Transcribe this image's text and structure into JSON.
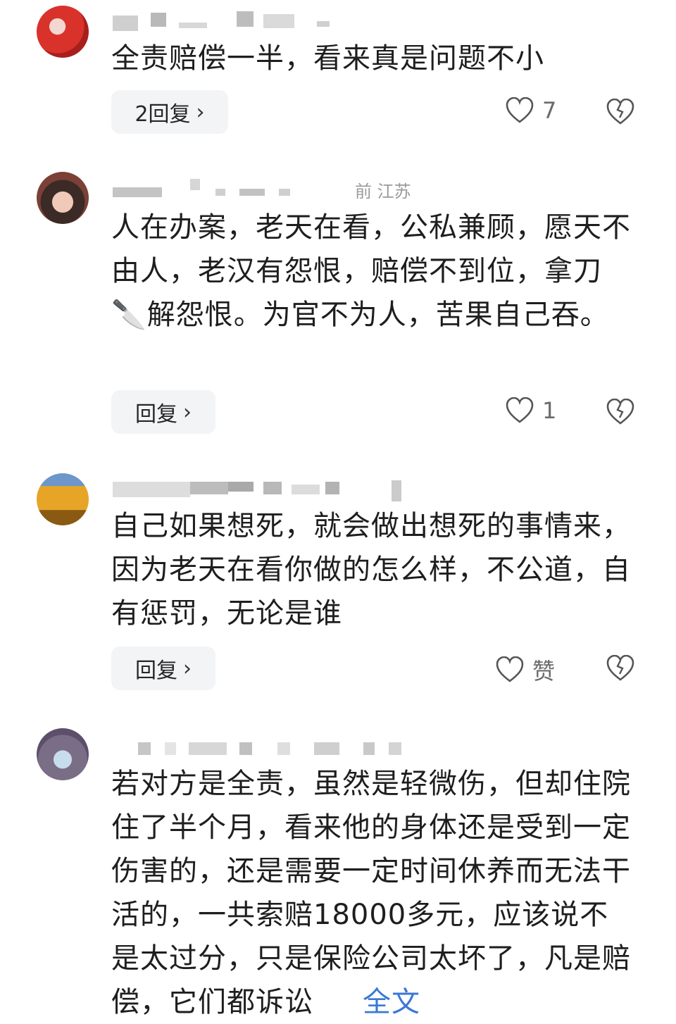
{
  "comments": [
    {
      "text": "全责赔偿一半，看来真是问题不小",
      "reply_label": "2回复",
      "likes": "7"
    },
    {
      "meta_visible": "前  江苏",
      "text": "人在办案，老天在看，公私兼顾，愿天不由人，老汉有怨恨，赔偿不到位，拿刀🔪解怨恨。为官不为人，苦果自己吞。",
      "reply_label": "回复",
      "likes": "1"
    },
    {
      "text": "自己如果想死，就会做出想死的事情来，因为老天在看你做的怎么样，不公道，自有惩罚，无论是谁",
      "reply_label": "回复",
      "likes": "赞"
    },
    {
      "text": "若对方是全责，虽然是轻微伤，但却住院住了半个月，看来他的身体还是受到一定伤害的，还是需要一定时间休养而无法干活的，一共索赔18000多元，应该说不是太过分，只是保险公司太坏了，凡是赔偿，它们都诉讼",
      "full_text_link": "全文"
    }
  ],
  "icons": {
    "like": "heart-outline-icon",
    "dislike": "broken-heart-icon",
    "chevron": "chevron-right-icon"
  },
  "colors": {
    "link": "#3a78d8",
    "button_bg": "#f3f4f6",
    "muted": "#6b6b6b"
  }
}
